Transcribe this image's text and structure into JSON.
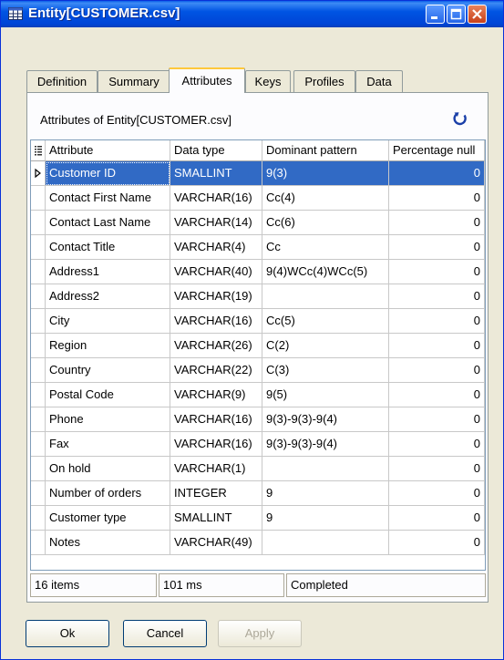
{
  "window": {
    "title": "Entity[CUSTOMER.csv]"
  },
  "tabs": [
    {
      "label": "Definition"
    },
    {
      "label": "Summary"
    },
    {
      "label": "Attributes"
    },
    {
      "label": "Keys"
    },
    {
      "label": "Profiles"
    },
    {
      "label": "Data"
    }
  ],
  "active_tab": "Attributes",
  "panel": {
    "title": "Attributes of Entity[CUSTOMER.csv]"
  },
  "grid": {
    "columns": [
      "Attribute",
      "Data type",
      "Dominant pattern",
      "Percentage null"
    ],
    "rows": [
      {
        "attribute": "Customer ID",
        "data_type": "SMALLINT",
        "pattern": "9(3)",
        "null_pct": "0"
      },
      {
        "attribute": "Contact First Name",
        "data_type": "VARCHAR(16)",
        "pattern": "Cc(4)",
        "null_pct": "0"
      },
      {
        "attribute": "Contact Last Name",
        "data_type": "VARCHAR(14)",
        "pattern": "Cc(6)",
        "null_pct": "0"
      },
      {
        "attribute": "Contact Title",
        "data_type": "VARCHAR(4)",
        "pattern": "Cc",
        "null_pct": "0"
      },
      {
        "attribute": "Address1",
        "data_type": "VARCHAR(40)",
        "pattern": "9(4)WCc(4)WCc(5)",
        "null_pct": "0"
      },
      {
        "attribute": "Address2",
        "data_type": "VARCHAR(19)",
        "pattern": "",
        "null_pct": "0"
      },
      {
        "attribute": "City",
        "data_type": "VARCHAR(16)",
        "pattern": "Cc(5)",
        "null_pct": "0"
      },
      {
        "attribute": "Region",
        "data_type": "VARCHAR(26)",
        "pattern": "C(2)",
        "null_pct": "0"
      },
      {
        "attribute": "Country",
        "data_type": "VARCHAR(22)",
        "pattern": "C(3)",
        "null_pct": "0"
      },
      {
        "attribute": "Postal Code",
        "data_type": "VARCHAR(9)",
        "pattern": "9(5)",
        "null_pct": "0"
      },
      {
        "attribute": "Phone",
        "data_type": "VARCHAR(16)",
        "pattern": "9(3)-9(3)-9(4)",
        "null_pct": "0"
      },
      {
        "attribute": "Fax",
        "data_type": "VARCHAR(16)",
        "pattern": "9(3)-9(3)-9(4)",
        "null_pct": "0"
      },
      {
        "attribute": "On hold",
        "data_type": "VARCHAR(1)",
        "pattern": "",
        "null_pct": "0"
      },
      {
        "attribute": "Number of orders",
        "data_type": "INTEGER",
        "pattern": "9",
        "null_pct": "0"
      },
      {
        "attribute": "Customer type",
        "data_type": "SMALLINT",
        "pattern": "9",
        "null_pct": "0"
      },
      {
        "attribute": "Notes",
        "data_type": "VARCHAR(49)",
        "pattern": "",
        "null_pct": "0"
      }
    ],
    "selected_row": 0
  },
  "status": {
    "items": "16 items",
    "time": "101 ms",
    "state": "Completed"
  },
  "buttons": {
    "ok": "Ok",
    "cancel": "Cancel",
    "apply": "Apply"
  },
  "colors": {
    "title_bar": "#0054e3",
    "selection": "#316ac5",
    "refresh_icon": "#1a3fa8"
  },
  "icons": {
    "title": "grid-icon",
    "refresh": "refresh-icon",
    "header_menu": "column-menu-icon",
    "row_indicator": "row-indicator-icon"
  }
}
